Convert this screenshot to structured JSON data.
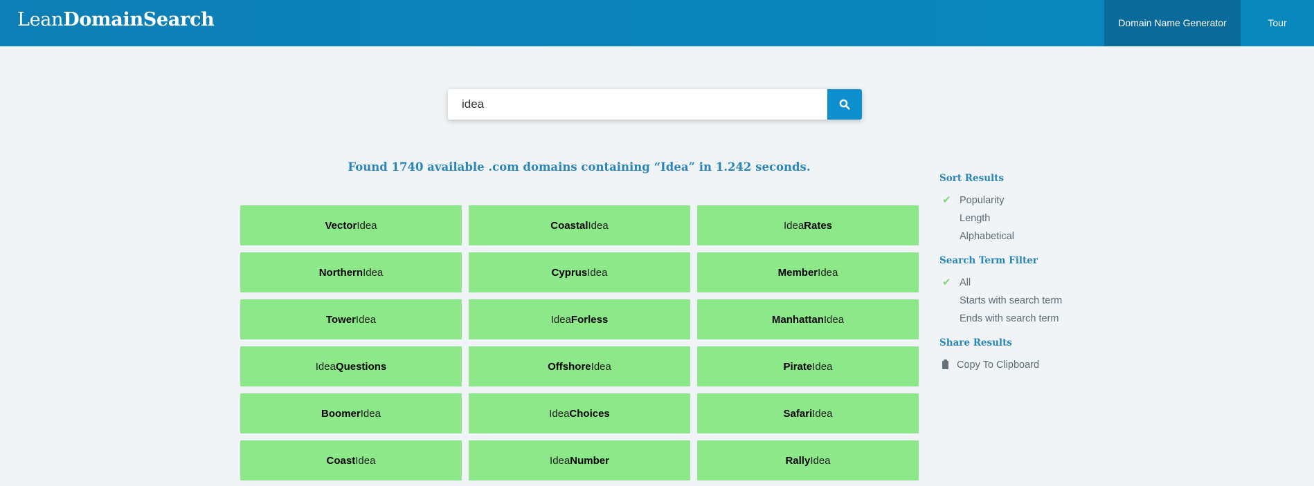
{
  "header": {
    "logo_light": "Lean",
    "logo_bold": "DomainSearch",
    "nav": [
      {
        "label": "Domain Name Generator",
        "active": true
      },
      {
        "label": "Tour",
        "active": false
      }
    ]
  },
  "search": {
    "value": "idea",
    "button_icon": "search-icon"
  },
  "results": {
    "heading": "Found 1740 available .com domains containing “Idea” in 1.242 seconds.",
    "domains": [
      {
        "bold": "Vector",
        "base": "Idea",
        "bold_first": true
      },
      {
        "bold": "Coastal",
        "base": "Idea",
        "bold_first": true
      },
      {
        "bold": "Rates",
        "base": "Idea",
        "bold_first": false
      },
      {
        "bold": "Northern",
        "base": "Idea",
        "bold_first": true
      },
      {
        "bold": "Cyprus",
        "base": "Idea",
        "bold_first": true
      },
      {
        "bold": "Member",
        "base": "Idea",
        "bold_first": true
      },
      {
        "bold": "Tower",
        "base": "Idea",
        "bold_first": true
      },
      {
        "bold": "Forless",
        "base": "Idea",
        "bold_first": false
      },
      {
        "bold": "Manhattan",
        "base": "Idea",
        "bold_first": true
      },
      {
        "bold": "Questions",
        "base": "Idea",
        "bold_first": false
      },
      {
        "bold": "Offshore",
        "base": "Idea",
        "bold_first": true
      },
      {
        "bold": "Pirate",
        "base": "Idea",
        "bold_first": true
      },
      {
        "bold": "Boomer",
        "base": "Idea",
        "bold_first": true
      },
      {
        "bold": "Choices",
        "base": "Idea",
        "bold_first": false
      },
      {
        "bold": "Safari",
        "base": "Idea",
        "bold_first": true
      },
      {
        "bold": "Coast",
        "base": "Idea",
        "bold_first": true
      },
      {
        "bold": "Number",
        "base": "Idea",
        "bold_first": false
      },
      {
        "bold": "Rally",
        "base": "Idea",
        "bold_first": true
      }
    ]
  },
  "sidebar": {
    "sort": {
      "heading": "Sort Results",
      "options": [
        {
          "label": "Popularity",
          "checked": true
        },
        {
          "label": "Length",
          "checked": false
        },
        {
          "label": "Alphabetical",
          "checked": false
        }
      ]
    },
    "filter": {
      "heading": "Search Term Filter",
      "options": [
        {
          "label": "All",
          "checked": true
        },
        {
          "label": "Starts with search term",
          "checked": false
        },
        {
          "label": "Ends with search term",
          "checked": false
        }
      ]
    },
    "share": {
      "heading": "Share Results",
      "copy_label": "Copy To Clipboard"
    }
  },
  "colors": {
    "header": "#0888bd",
    "active_nav": "#0a6a99",
    "domain_card": "#8de889",
    "accent_text": "#2a85b8",
    "check": "#8ad47f"
  }
}
